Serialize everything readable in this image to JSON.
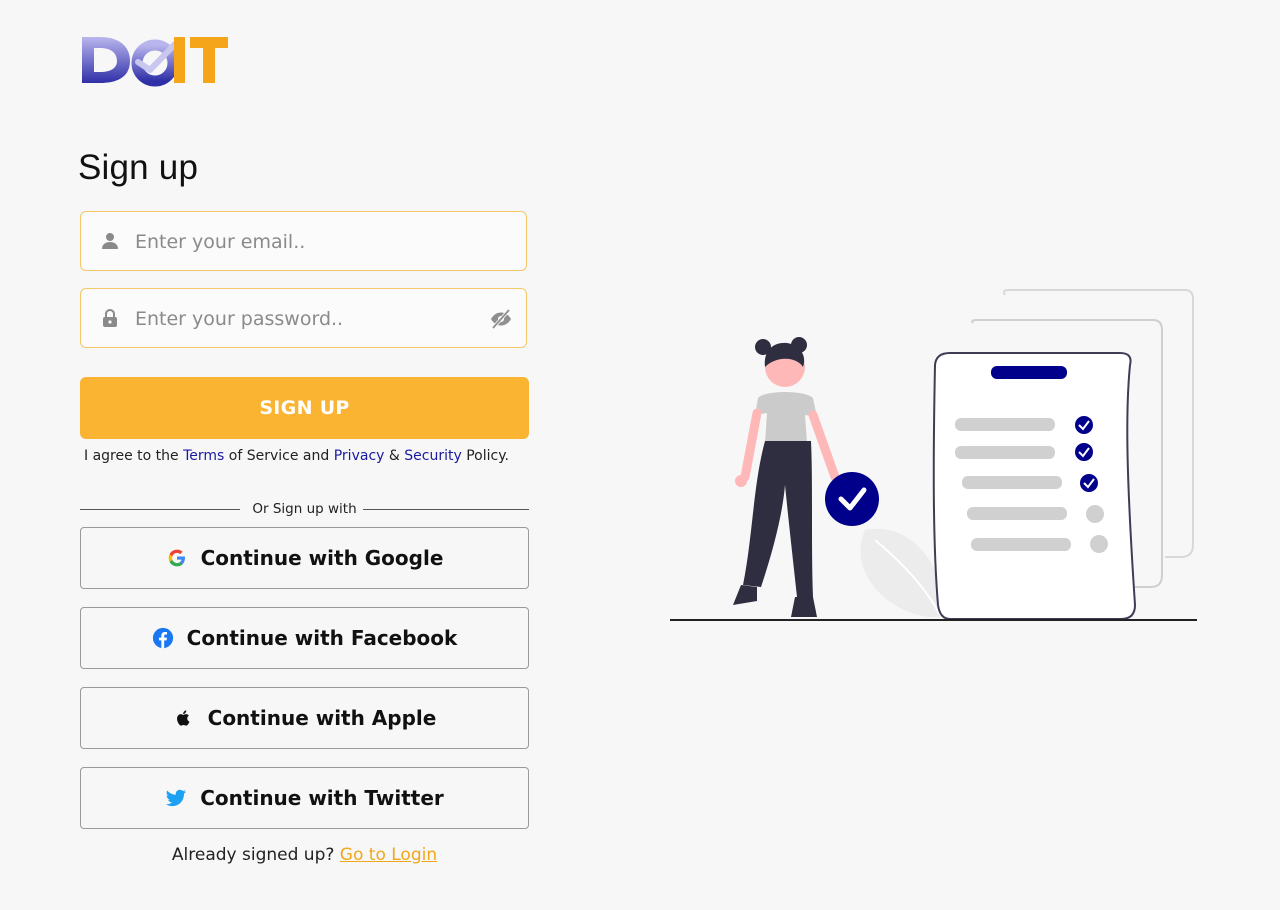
{
  "brand": {
    "name": "DoIT",
    "colors": {
      "primary": "#fab432",
      "accent_blue": "#1a1aa0",
      "navy": "#00008b"
    }
  },
  "form": {
    "title": "Sign up",
    "email_placeholder": "Enter your email..",
    "password_placeholder": "Enter your password..",
    "signup_label": "SIGN UP",
    "agree": {
      "prefix": "I agree to the",
      "terms": "Terms",
      "of_service": "of Service and",
      "privacy": "Privacy",
      "amp": "&",
      "security": "Security",
      "policy": "Policy."
    },
    "divider": "Or Sign up with"
  },
  "social": [
    {
      "label": "Continue with Google",
      "icon": "google-icon"
    },
    {
      "label": "Continue with Facebook",
      "icon": "facebook-icon"
    },
    {
      "label": "Continue with Apple",
      "icon": "apple-icon"
    },
    {
      "label": "Continue with Twitter",
      "icon": "twitter-icon"
    }
  ],
  "footer": {
    "prompt": "Already signed up?",
    "login_link": "Go to Login"
  },
  "icons": {
    "email": "user-icon",
    "password": "lock-icon",
    "toggle": "eye-off-icon"
  }
}
